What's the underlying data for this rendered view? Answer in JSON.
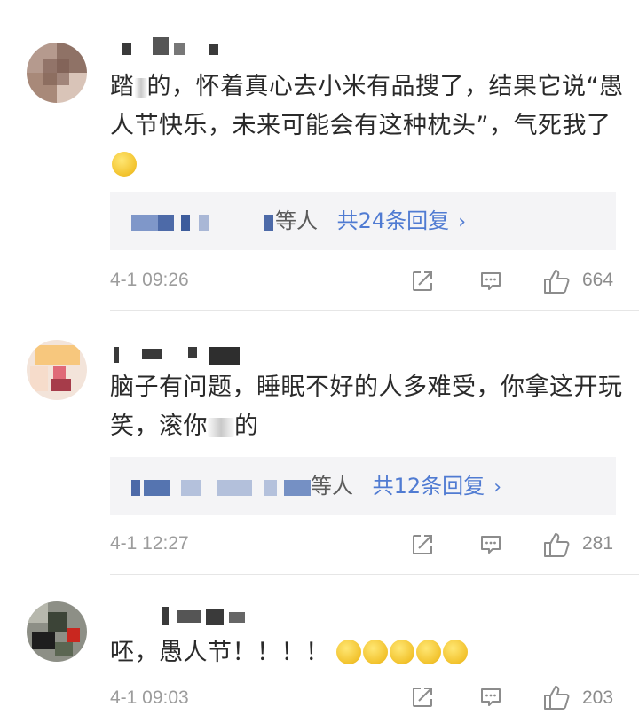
{
  "comments": [
    {
      "text_before": "踏",
      "text_after": "的，怀着真心去小米有品搜了，结果它说“愚人节快乐，未来可能会有这种枕头”，气死我了",
      "emoji": "smile-emoji",
      "reply_suffix": "等人",
      "reply_link": "共24条回复",
      "time": "4-1 09:26",
      "likes": "664"
    },
    {
      "text_before": "脑子有问题，睡眠不好的人多难受，你拿这开玩笑，滚你",
      "text_after": "的",
      "reply_suffix": "等人",
      "reply_link": "共12条回复",
      "time": "4-1 12:27",
      "likes": "281"
    },
    {
      "text_before": "呸，愚人节！！！！",
      "text_after": "",
      "emoji": "dizzy-emoji",
      "time": "4-1 09:03",
      "likes": "203"
    }
  ],
  "icons": {
    "share": "share-icon",
    "comment": "comment-icon",
    "like": "like-icon",
    "reply_chevron": "chevron-right-icon"
  },
  "colors": {
    "link": "#507bd2",
    "meta": "#9c9c9c",
    "reply_bg": "#f4f4f6"
  }
}
